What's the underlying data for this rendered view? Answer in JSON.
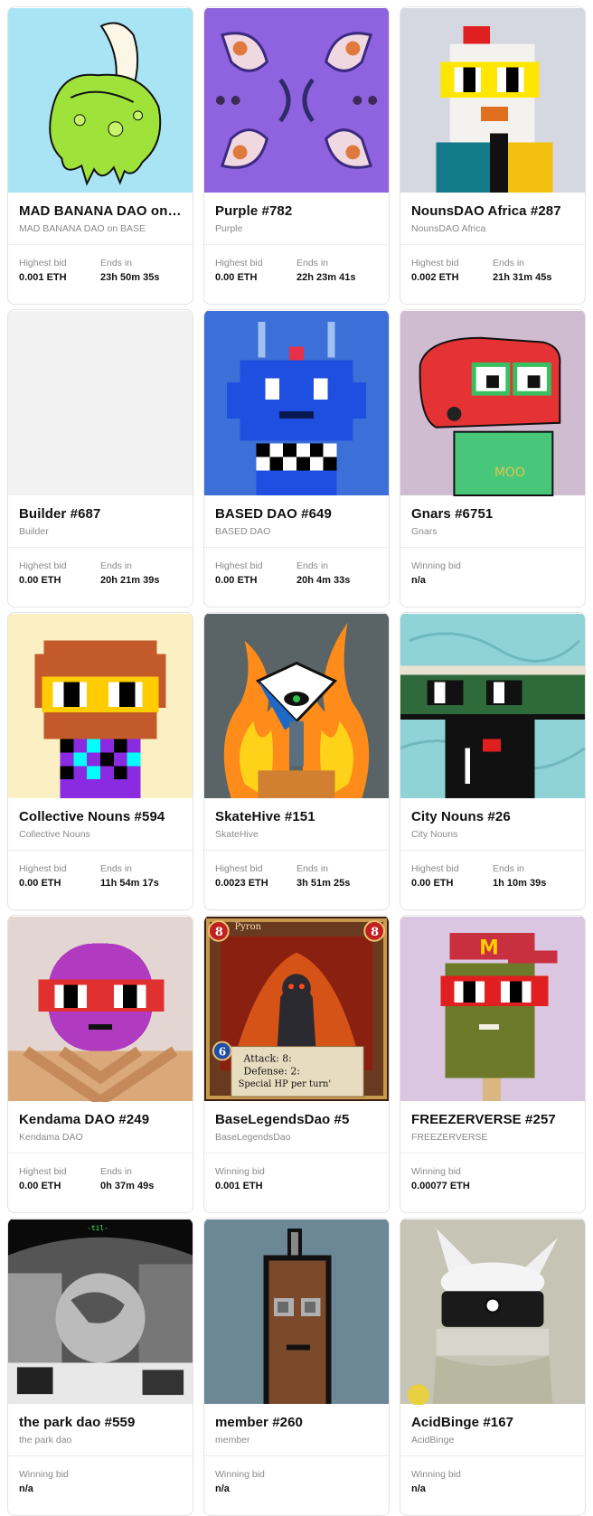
{
  "labels": {
    "highest_bid": "Highest bid",
    "ends_in": "Ends in",
    "winning_bid": "Winning bid"
  },
  "cards": [
    {
      "title": "MAD BANANA DAO on BASE",
      "subtitle": "MAD BANANA DAO on BASE",
      "bid": "0.001 ETH",
      "ends": "23h 50m 35s",
      "art": "banana-art",
      "bg": "#a9e4f5"
    },
    {
      "title": "Purple #782",
      "subtitle": "Purple",
      "bid": "0.00 ETH",
      "ends": "22h 23m 41s",
      "art": "purple-art",
      "bg": "#8f62e0"
    },
    {
      "title": "NounsDAO Africa #287",
      "subtitle": "NounsDAO Africa",
      "bid": "0.002 ETH",
      "ends": "21h 31m 45s",
      "art": "noun-africa-art",
      "bg": "#d5d7e1"
    },
    {
      "title": "Builder #687",
      "subtitle": "Builder",
      "bid": "0.00 ETH",
      "ends": "20h 21m 39s",
      "art": "builder-art",
      "bg": "#f2f2f2"
    },
    {
      "title": "BASED DAO #649",
      "subtitle": "BASED DAO",
      "bid": "0.00 ETH",
      "ends": "20h 4m 33s",
      "art": "based-art",
      "bg": "#3c6fd8"
    },
    {
      "title": "Gnars #6751",
      "subtitle": "Gnars",
      "winning": "n/a",
      "art": "gnars-art",
      "bg": "#d0bcd0"
    },
    {
      "title": "Collective Nouns #594",
      "subtitle": "Collective Nouns",
      "bid": "0.00 ETH",
      "ends": "11h 54m 17s",
      "art": "collective-art",
      "bg": "#fbf0c4"
    },
    {
      "title": "SkateHive #151",
      "subtitle": "SkateHive",
      "bid": "0.0023 ETH",
      "ends": "3h 51m 25s",
      "art": "skatehive-art",
      "bg": "#5a6466"
    },
    {
      "title": "City Nouns #26",
      "subtitle": "City Nouns",
      "bid": "0.00 ETH",
      "ends": "1h 10m 39s",
      "art": "city-art",
      "bg": "#8fd3d6"
    },
    {
      "title": "Kendama DAO #249",
      "subtitle": "Kendama DAO",
      "bid": "0.00 ETH",
      "ends": "0h 37m 49s",
      "art": "kendama-art",
      "bg": "#e3d6d2"
    },
    {
      "title": "BaseLegendsDao #5",
      "subtitle": "BaseLegendsDao",
      "winning": "0.001 ETH",
      "art": "legends-art",
      "bg": "#3a1e12",
      "card_text": {
        "name": "Pyron",
        "cost": "8",
        "stat": "6",
        "attack": "Attack:  8:",
        "defense": "Defense:  2:",
        "special": "Special HP  per turn'"
      }
    },
    {
      "title": "FREEZERVERSE #257",
      "subtitle": "FREEZERVERSE",
      "winning": "0.00077 ETH",
      "art": "freezer-art",
      "bg": "#dac6e0"
    },
    {
      "title": "the park dao #559",
      "subtitle": "the park dao",
      "winning": "n/a",
      "art": "park-art",
      "bg": "#0a0a0a",
      "sign": "-til-"
    },
    {
      "title": "member #260",
      "subtitle": "member",
      "winning": "n/a",
      "art": "member-art",
      "bg": "#6c8796"
    },
    {
      "title": "AcidBinge #167",
      "subtitle": "AcidBinge",
      "winning": "n/a",
      "art": "acid-art",
      "bg": "#c6c4b4"
    }
  ]
}
